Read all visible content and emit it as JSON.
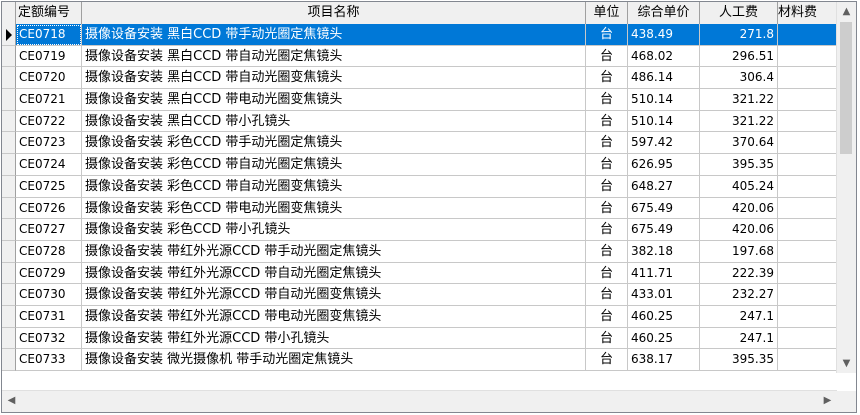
{
  "columns": {
    "code": "定额编号",
    "name": "项目名称",
    "unit": "单位",
    "price": "综合单价",
    "labor": "人工费",
    "material": "材料费"
  },
  "rows": [
    {
      "code": "CE0718",
      "name": "摄像设备安装 黑白CCD 带手动光圈定焦镜头",
      "unit": "台",
      "price": "438.49",
      "labor": "271.8",
      "selected": true
    },
    {
      "code": "CE0719",
      "name": "摄像设备安装 黑白CCD 带自动光圈定焦镜头",
      "unit": "台",
      "price": "468.02",
      "labor": "296.51"
    },
    {
      "code": "CE0720",
      "name": "摄像设备安装 黑白CCD 带自动光圈变焦镜头",
      "unit": "台",
      "price": "486.14",
      "labor": "306.4"
    },
    {
      "code": "CE0721",
      "name": "摄像设备安装 黑白CCD 带电动光圈变焦镜头",
      "unit": "台",
      "price": "510.14",
      "labor": "321.22"
    },
    {
      "code": "CE0722",
      "name": "摄像设备安装 黑白CCD 带小孔镜头",
      "unit": "台",
      "price": "510.14",
      "labor": "321.22"
    },
    {
      "code": "CE0723",
      "name": "摄像设备安装 彩色CCD 带手动光圈定焦镜头",
      "unit": "台",
      "price": "597.42",
      "labor": "370.64"
    },
    {
      "code": "CE0724",
      "name": "摄像设备安装 彩色CCD 带自动光圈定焦镜头",
      "unit": "台",
      "price": "626.95",
      "labor": "395.35"
    },
    {
      "code": "CE0725",
      "name": "摄像设备安装 彩色CCD 带自动光圈变焦镜头",
      "unit": "台",
      "price": "648.27",
      "labor": "405.24"
    },
    {
      "code": "CE0726",
      "name": "摄像设备安装 彩色CCD 带电动光圈变焦镜头",
      "unit": "台",
      "price": "675.49",
      "labor": "420.06"
    },
    {
      "code": "CE0727",
      "name": "摄像设备安装 彩色CCD 带小孔镜头",
      "unit": "台",
      "price": "675.49",
      "labor": "420.06"
    },
    {
      "code": "CE0728",
      "name": "摄像设备安装 带红外光源CCD 带手动光圈定焦镜头",
      "unit": "台",
      "price": "382.18",
      "labor": "197.68"
    },
    {
      "code": "CE0729",
      "name": "摄像设备安装 带红外光源CCD 带自动光圈定焦镜头",
      "unit": "台",
      "price": "411.71",
      "labor": "222.39"
    },
    {
      "code": "CE0730",
      "name": "摄像设备安装 带红外光源CCD 带自动光圈变焦镜头",
      "unit": "台",
      "price": "433.01",
      "labor": "232.27"
    },
    {
      "code": "CE0731",
      "name": "摄像设备安装 带红外光源CCD 带电动光圈变焦镜头",
      "unit": "台",
      "price": "460.25",
      "labor": "247.1"
    },
    {
      "code": "CE0732",
      "name": "摄像设备安装 带红外光源CCD 带小孔镜头",
      "unit": "台",
      "price": "460.25",
      "labor": "247.1"
    },
    {
      "code": "CE0733",
      "name": "摄像设备安装 微光摄像机 带手动光圈定焦镜头",
      "unit": "台",
      "price": "638.17",
      "labor": "395.35"
    }
  ],
  "scroll": {
    "up": "▲",
    "down": "▼",
    "left": "◀",
    "right": "▶"
  },
  "icons": {
    "row_indicator": "current-row-arrow-icon"
  },
  "colors": {
    "selection": "#0078d7",
    "header_bg": "#f0f0f0"
  }
}
